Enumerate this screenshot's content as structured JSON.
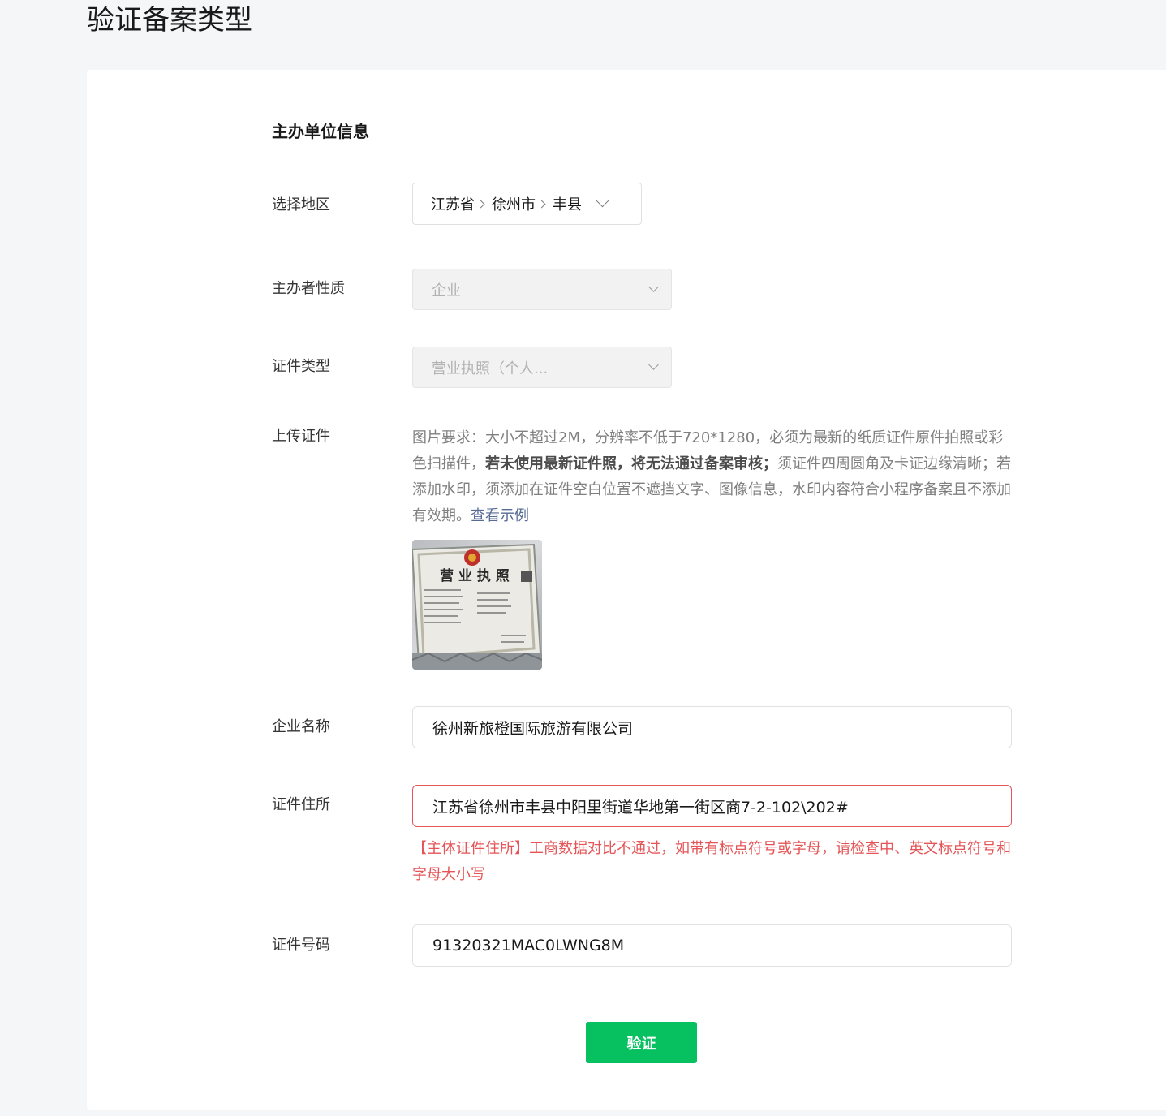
{
  "page": {
    "title": "验证备案类型"
  },
  "section": {
    "title": "主办单位信息"
  },
  "region": {
    "label": "选择地区",
    "province": "江苏省",
    "city": "徐州市",
    "county": "丰县"
  },
  "sponsor_nature": {
    "label": "主办者性质",
    "value": "企业"
  },
  "cert_type": {
    "label": "证件类型",
    "value": "营业执照（个人..."
  },
  "upload": {
    "label": "上传证件",
    "desc_part1": "图片要求：大小不超过2M，分辨率不低于720*1280，必须为最新的纸质证件原件拍照或彩色扫描件，",
    "desc_bold": "若未使用最新证件照，将无法通过备案审核；",
    "desc_part2": "须证件四周圆角及卡证边缘清晰；若添加水印，须添加在证件空白位置不遮挡文字、图像信息，水印内容符合小程序备案且不添加有效期。",
    "example_link": "查看示例",
    "thumb_text": "营 业 执 照"
  },
  "company_name": {
    "label": "企业名称",
    "value": "徐州新旅橙国际旅游有限公司"
  },
  "cert_address": {
    "label": "证件住所",
    "value": "江苏省徐州市丰县中阳里街道华地第一街区商7-2-102\\202#",
    "error": "【主体证件住所】工商数据对比不通过，如带有标点符号或字母，请检查中、英文标点符号和字母大小写"
  },
  "cert_number": {
    "label": "证件号码",
    "value": "91320321MAC0LWNG8M"
  },
  "actions": {
    "verify_label": "验证"
  },
  "colors": {
    "primary": "#07c160",
    "error": "#e55456",
    "link": "#576b95"
  }
}
